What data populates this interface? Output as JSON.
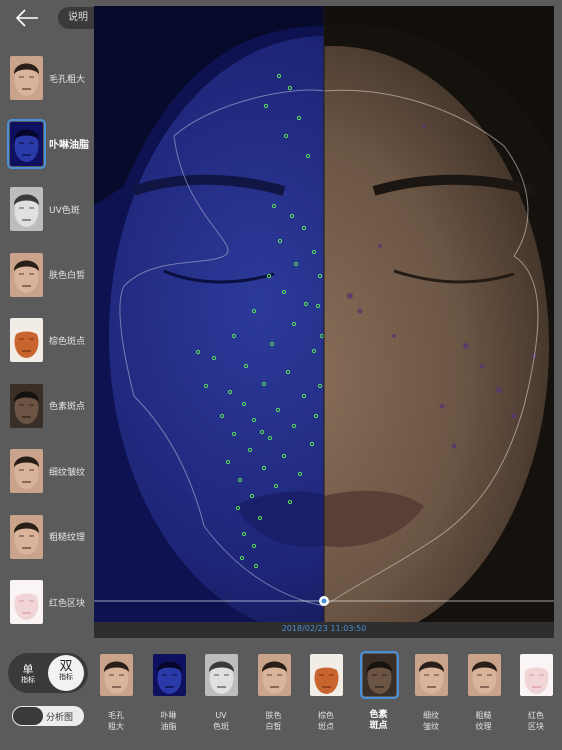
{
  "header": {
    "back_icon": "back-arrow-icon",
    "help_label": "说明"
  },
  "sidebar": {
    "items": [
      {
        "label": "毛孔粗大",
        "thumb": "normal",
        "active": false
      },
      {
        "label": "卟啉油脂",
        "thumb": "blue",
        "active": true
      },
      {
        "label": "UV色斑",
        "thumb": "gray",
        "active": false
      },
      {
        "label": "肤色白皙",
        "thumb": "normal",
        "active": false
      },
      {
        "label": "棕色斑点",
        "thumb": "brown",
        "active": false
      },
      {
        "label": "色素斑点",
        "thumb": "dark",
        "active": false
      },
      {
        "label": "细纹皱纹",
        "thumb": "normal",
        "active": false
      },
      {
        "label": "粗糙纹理",
        "thumb": "normal",
        "active": false
      },
      {
        "label": "红色区块",
        "thumb": "pink",
        "active": false
      }
    ]
  },
  "viewer": {
    "timestamp": "2018/02/23 11:03:50"
  },
  "mode": {
    "single_main": "单",
    "single_sub": "指标",
    "double_main": "双",
    "double_sub": "指标"
  },
  "analysis": {
    "label": "分析图",
    "enabled": false
  },
  "bottom": {
    "items": [
      {
        "line1": "毛孔",
        "line2": "粗大",
        "thumb": "normal",
        "active": false
      },
      {
        "line1": "卟啉",
        "line2": "油脂",
        "thumb": "blue",
        "active": false
      },
      {
        "line1": "UV",
        "line2": "色斑",
        "thumb": "gray",
        "active": false
      },
      {
        "line1": "肤色",
        "line2": "白皙",
        "thumb": "normal",
        "active": false
      },
      {
        "line1": "棕色",
        "line2": "斑点",
        "thumb": "brown",
        "active": false
      },
      {
        "line1": "色素",
        "line2": "斑点",
        "thumb": "dark",
        "active": true
      },
      {
        "line1": "细纹",
        "line2": "皱纹",
        "thumb": "normal",
        "active": false
      },
      {
        "line1": "粗糙",
        "line2": "纹理",
        "thumb": "normal",
        "active": false
      },
      {
        "line1": "红色",
        "line2": "区块",
        "thumb": "pink",
        "active": false
      }
    ]
  },
  "colors": {
    "accent": "#4a90d9",
    "background": "#5b5b5b",
    "timestamp": "#4a8fd6"
  }
}
